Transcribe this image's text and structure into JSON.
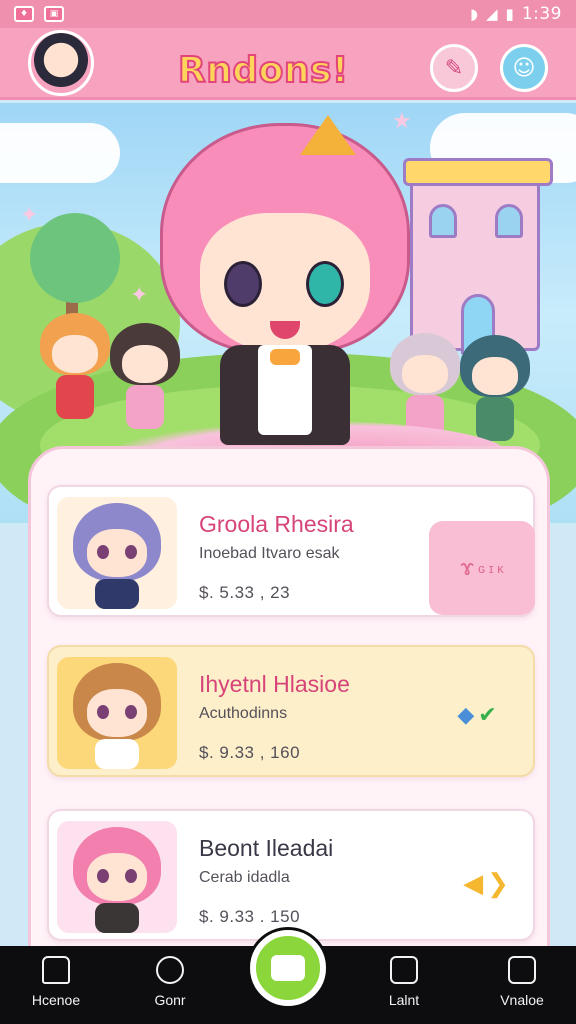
{
  "status_bar": {
    "time": "1:39",
    "icons": [
      "notification-icon",
      "image-icon",
      "wifi-icon",
      "signal-icon",
      "battery-icon"
    ]
  },
  "header": {
    "title": "Rndons!",
    "buttons": [
      "edit-icon",
      "menu-icon"
    ]
  },
  "cards": [
    {
      "name": "Groola Rhesira",
      "subtitle": "Inoebad Itvaro esak",
      "price": "$. 5.33 ,  23",
      "action_text": "ɢ ɪ ᴋ",
      "accent": "#f9bed3"
    },
    {
      "name": "Ihyetnl Hlasioe",
      "subtitle": "Acuthodinns",
      "price": "$. 9.33 ,  160",
      "action_text": "✔",
      "accent": "#fdefc9"
    },
    {
      "name": "Beont Ileadai",
      "subtitle": "Cerab idadla",
      "price": "$. 9.33 . 150",
      "action_text": "❯",
      "accent": "#ffffff"
    }
  ],
  "bottom_nav": {
    "items": [
      {
        "label": "Hcenoe",
        "icon": "home-icon"
      },
      {
        "label": "Gonr",
        "icon": "clock-icon"
      },
      {
        "label": "Lalnt",
        "icon": "cards-icon"
      },
      {
        "label": "Vnaloe",
        "icon": "bag-icon"
      }
    ]
  },
  "colors": {
    "brand_pink": "#f7a3c0",
    "title_yellow": "#ffd45a",
    "fab_green": "#8bd63a"
  }
}
